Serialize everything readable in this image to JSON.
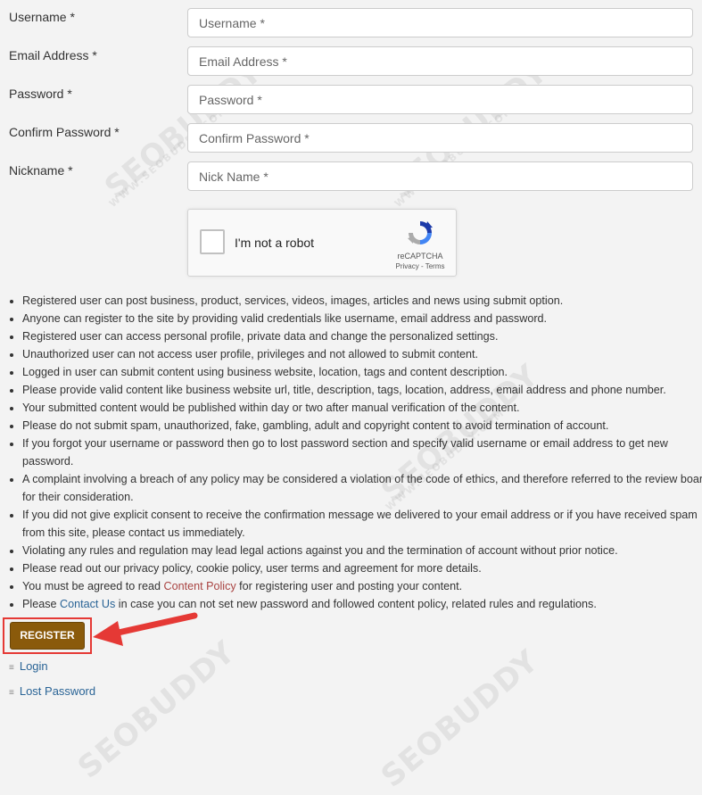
{
  "form": {
    "fields": [
      {
        "label": "Username *",
        "placeholder": "Username *"
      },
      {
        "label": "Email Address *",
        "placeholder": "Email Address *"
      },
      {
        "label": "Password *",
        "placeholder": "Password *"
      },
      {
        "label": "Confirm Password *",
        "placeholder": "Confirm Password *"
      },
      {
        "label": "Nickname *",
        "placeholder": "Nick Name *"
      }
    ]
  },
  "captcha": {
    "label": "I'm not a robot",
    "brand": "reCAPTCHA",
    "privacy": "Privacy",
    "separator": " - ",
    "terms": "Terms"
  },
  "notes": [
    "Registered user can post business, product, services, videos, images, articles and news using submit option.",
    "Anyone can register to the site by providing valid credentials like username, email address and password.",
    "Registered user can access personal profile, private data and change the personalized settings.",
    "Unauthorized user can not access user profile, privileges and not allowed to submit content.",
    "Logged in user can submit content using business website, location, tags and content description.",
    "Please provide valid content like business website url, title, description, tags, location, address, email address and phone number.",
    "Your submitted content would be published within day or two after manual verification of the content.",
    "Please do not submit spam, unauthorized, fake, gambling, adult and copyright content to avoid termination of account.",
    "If you forgot your username or password then go to lost password section and specify valid username or email address to get new password.",
    "A complaint involving a breach of any policy may be considered a violation of the code of ethics, and therefore referred to the review board for their consideration.",
    "If you did not give explicit consent to receive the confirmation message we delivered to your email address or if you have received spam from this site, please contact us immediately.",
    "Violating any rules and regulation may lead legal actions against you and the termination of account without prior notice.",
    "Please read out our privacy policy, cookie policy, user terms and agreement for more details."
  ],
  "note_content_policy": {
    "before": "You must be agreed to read ",
    "link": "Content Policy",
    "after": " for registering user and posting your content."
  },
  "note_contact": {
    "before": "Please ",
    "link": "Contact Us",
    "after": " in case you can not set new password and followed content policy, related rules and regulations."
  },
  "register_label": "REGISTER",
  "footer_links": [
    "Login",
    "Lost Password"
  ],
  "watermark": {
    "big": "SEOBUDDY",
    "small": "WWW.SEOBUDDY.COM"
  },
  "colors": {
    "register_bg": "#8a5a0b",
    "highlight": "#e53935",
    "link": "#2a6496"
  },
  "icons": [
    "recaptcha-logo-icon",
    "red-arrow-icon",
    "list-icon"
  ]
}
